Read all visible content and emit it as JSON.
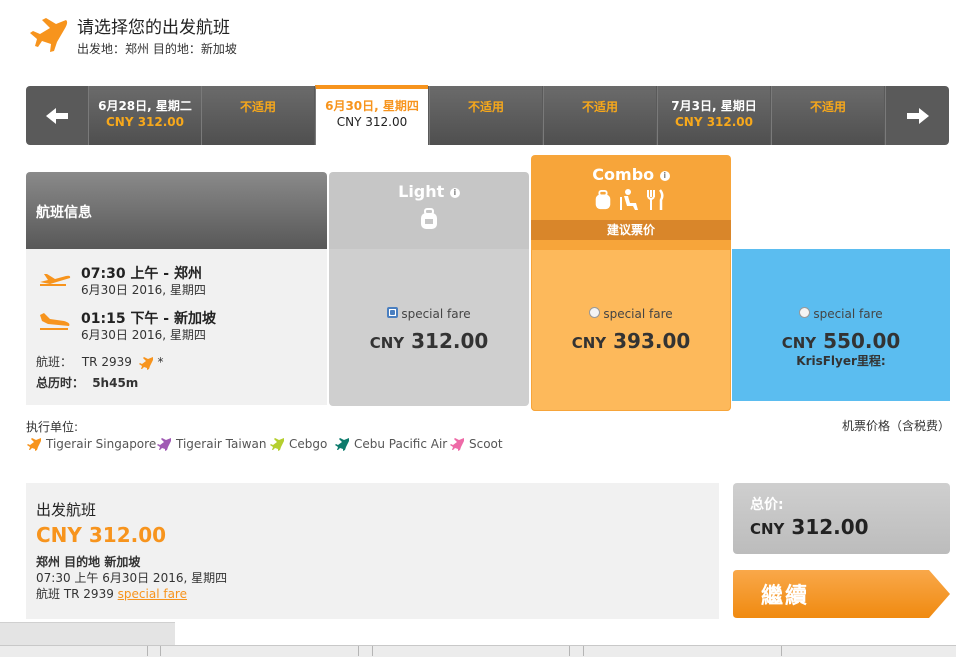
{
  "header": {
    "title": "请选择您的出发航班",
    "route_label": "出发地：郑州 目的地：新加坡",
    "icon": "plane-icon"
  },
  "date_bar": {
    "prev_icon": "arrow-left-icon",
    "next_icon": "arrow-right-icon",
    "cells": [
      {
        "date": "6月28日, 星期二",
        "price": "CNY 312.00"
      },
      {
        "na": "不适用"
      },
      {
        "date": "6月30日, 星期四",
        "price": "CNY 312.00",
        "selected": true
      },
      {
        "na": "不适用"
      },
      {
        "na": "不适用"
      },
      {
        "date": "7月3日, 星期日",
        "price": "CNY 312.00"
      },
      {
        "na": "不适用"
      }
    ]
  },
  "flight_info": {
    "heading": "航班信息",
    "depart": {
      "time": "07:30 上午 - 郑州",
      "date": "6月30日 2016, 星期四"
    },
    "arrive": {
      "time": "01:15 下午 - 新加坡",
      "date": "6月30日 2016, 星期四"
    },
    "flight_label": "航班：",
    "flight_no": "TR 2939",
    "flight_star": "*",
    "duration_label": "总历时：",
    "duration": "5h45m"
  },
  "fares": {
    "light": {
      "title": "Light",
      "radio_label": "special fare",
      "currency": "CNY",
      "amount": "312.00",
      "selected": true
    },
    "combo": {
      "title": "Combo",
      "badge": "建议票价",
      "radio_label": "special fare",
      "currency": "CNY",
      "amount": "393.00"
    },
    "krisflyer": {
      "radio_label": "special fare",
      "currency": "CNY",
      "amount": "550.00",
      "note": "KrisFlyer里程:"
    }
  },
  "operators": {
    "label": "执行单位:",
    "price_note": "机票价格（含税费）",
    "airlines": [
      {
        "name": "Tigerair Singapore",
        "color": "#f7941d"
      },
      {
        "name": "Tigerair Taiwan",
        "color": "#a05ab4"
      },
      {
        "name": "Cebgo",
        "color": "#b5cf2f"
      },
      {
        "name": "Cebu Pacific Air",
        "color": "#0d7b6c"
      },
      {
        "name": "Scoot",
        "color": "#ee6aa7"
      }
    ]
  },
  "summary": {
    "title": "出发航班",
    "price": "CNY 312.00",
    "route": "郑州 目的地 新加坡",
    "time": "07:30 上午 6月30日 2016, 星期四",
    "flight_prefix": "航班 TR 2939 ",
    "fare_link": "special fare"
  },
  "total": {
    "label": "总价:",
    "currency": "CNY",
    "amount": "312.00"
  },
  "continue_label": "繼續",
  "colors": {
    "accent": "#f7941d",
    "krisflyer": "#5bbdf0",
    "combo": "#f7a53a"
  }
}
